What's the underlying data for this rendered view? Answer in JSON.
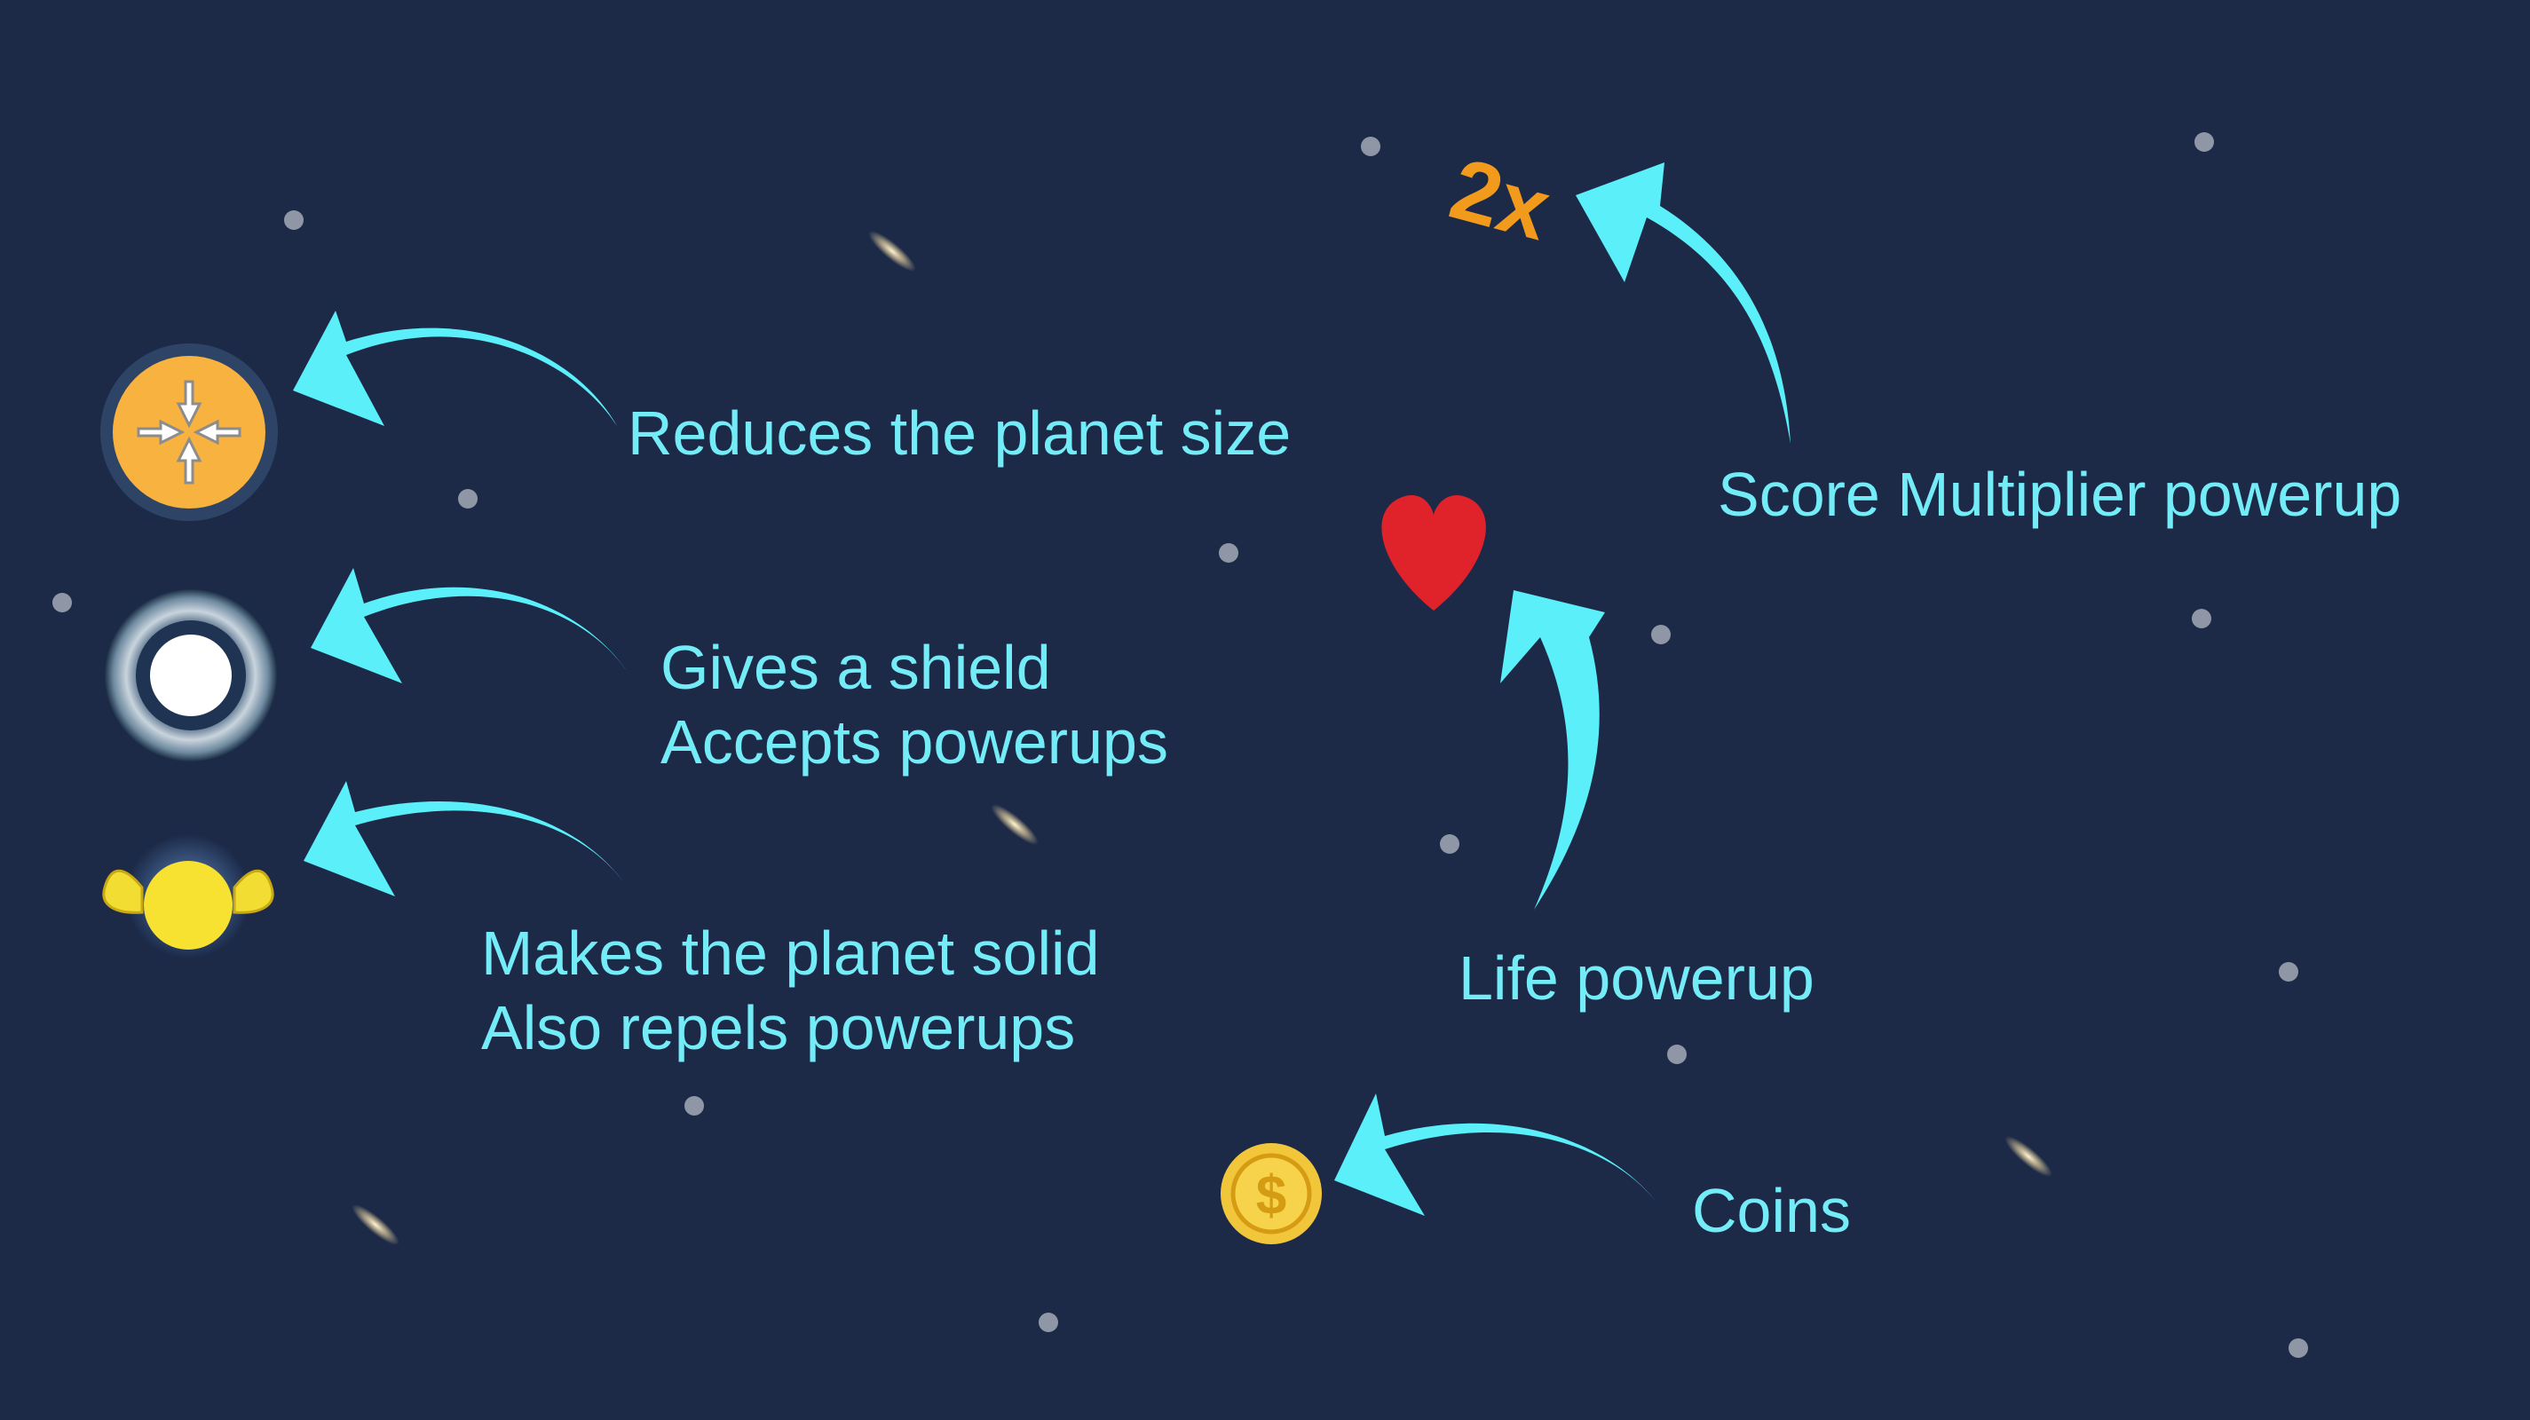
{
  "colors": {
    "background": "#1c2a48",
    "text": "#73ecf7",
    "arrow": "#5beff9",
    "star": "#8f97a7"
  },
  "powerups": [
    {
      "id": "shrink",
      "icon": "shrink-arrows-icon",
      "lines": [
        "Reduces the planet size"
      ]
    },
    {
      "id": "shield",
      "icon": "shield-ring-icon",
      "lines": [
        "Gives a shield",
        "Accepts powerups"
      ]
    },
    {
      "id": "solid",
      "icon": "muscle-planet-icon",
      "lines": [
        "Makes the planet solid",
        "Also repels powerups"
      ]
    },
    {
      "id": "multiplier",
      "icon": "2x-icon",
      "icon_text": "2x",
      "lines": [
        "Score Multiplier powerup"
      ]
    },
    {
      "id": "life",
      "icon": "heart-icon",
      "lines": [
        "Life powerup"
      ]
    },
    {
      "id": "coins",
      "icon": "coin-icon",
      "icon_text": "$",
      "lines": [
        "Coins"
      ]
    }
  ]
}
